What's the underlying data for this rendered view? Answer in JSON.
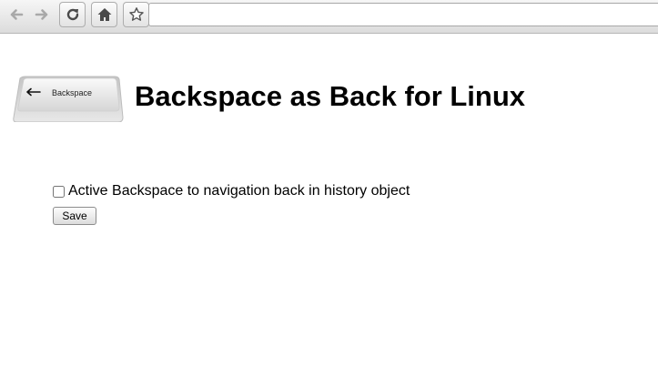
{
  "browser": {
    "toolbar": {
      "back_icon": "arrow-left-icon",
      "forward_icon": "arrow-right-icon",
      "reload_icon": "reload-icon",
      "home_icon": "home-icon",
      "bookmark_icon": "star-icon",
      "address_value": ""
    }
  },
  "header": {
    "key_image_label": "Backspace",
    "title": "Backspace as Back for Linux"
  },
  "options": {
    "backspace_checkbox_checked": false,
    "backspace_label": "Active Backspace to navigation back in history object",
    "save_label": "Save"
  }
}
